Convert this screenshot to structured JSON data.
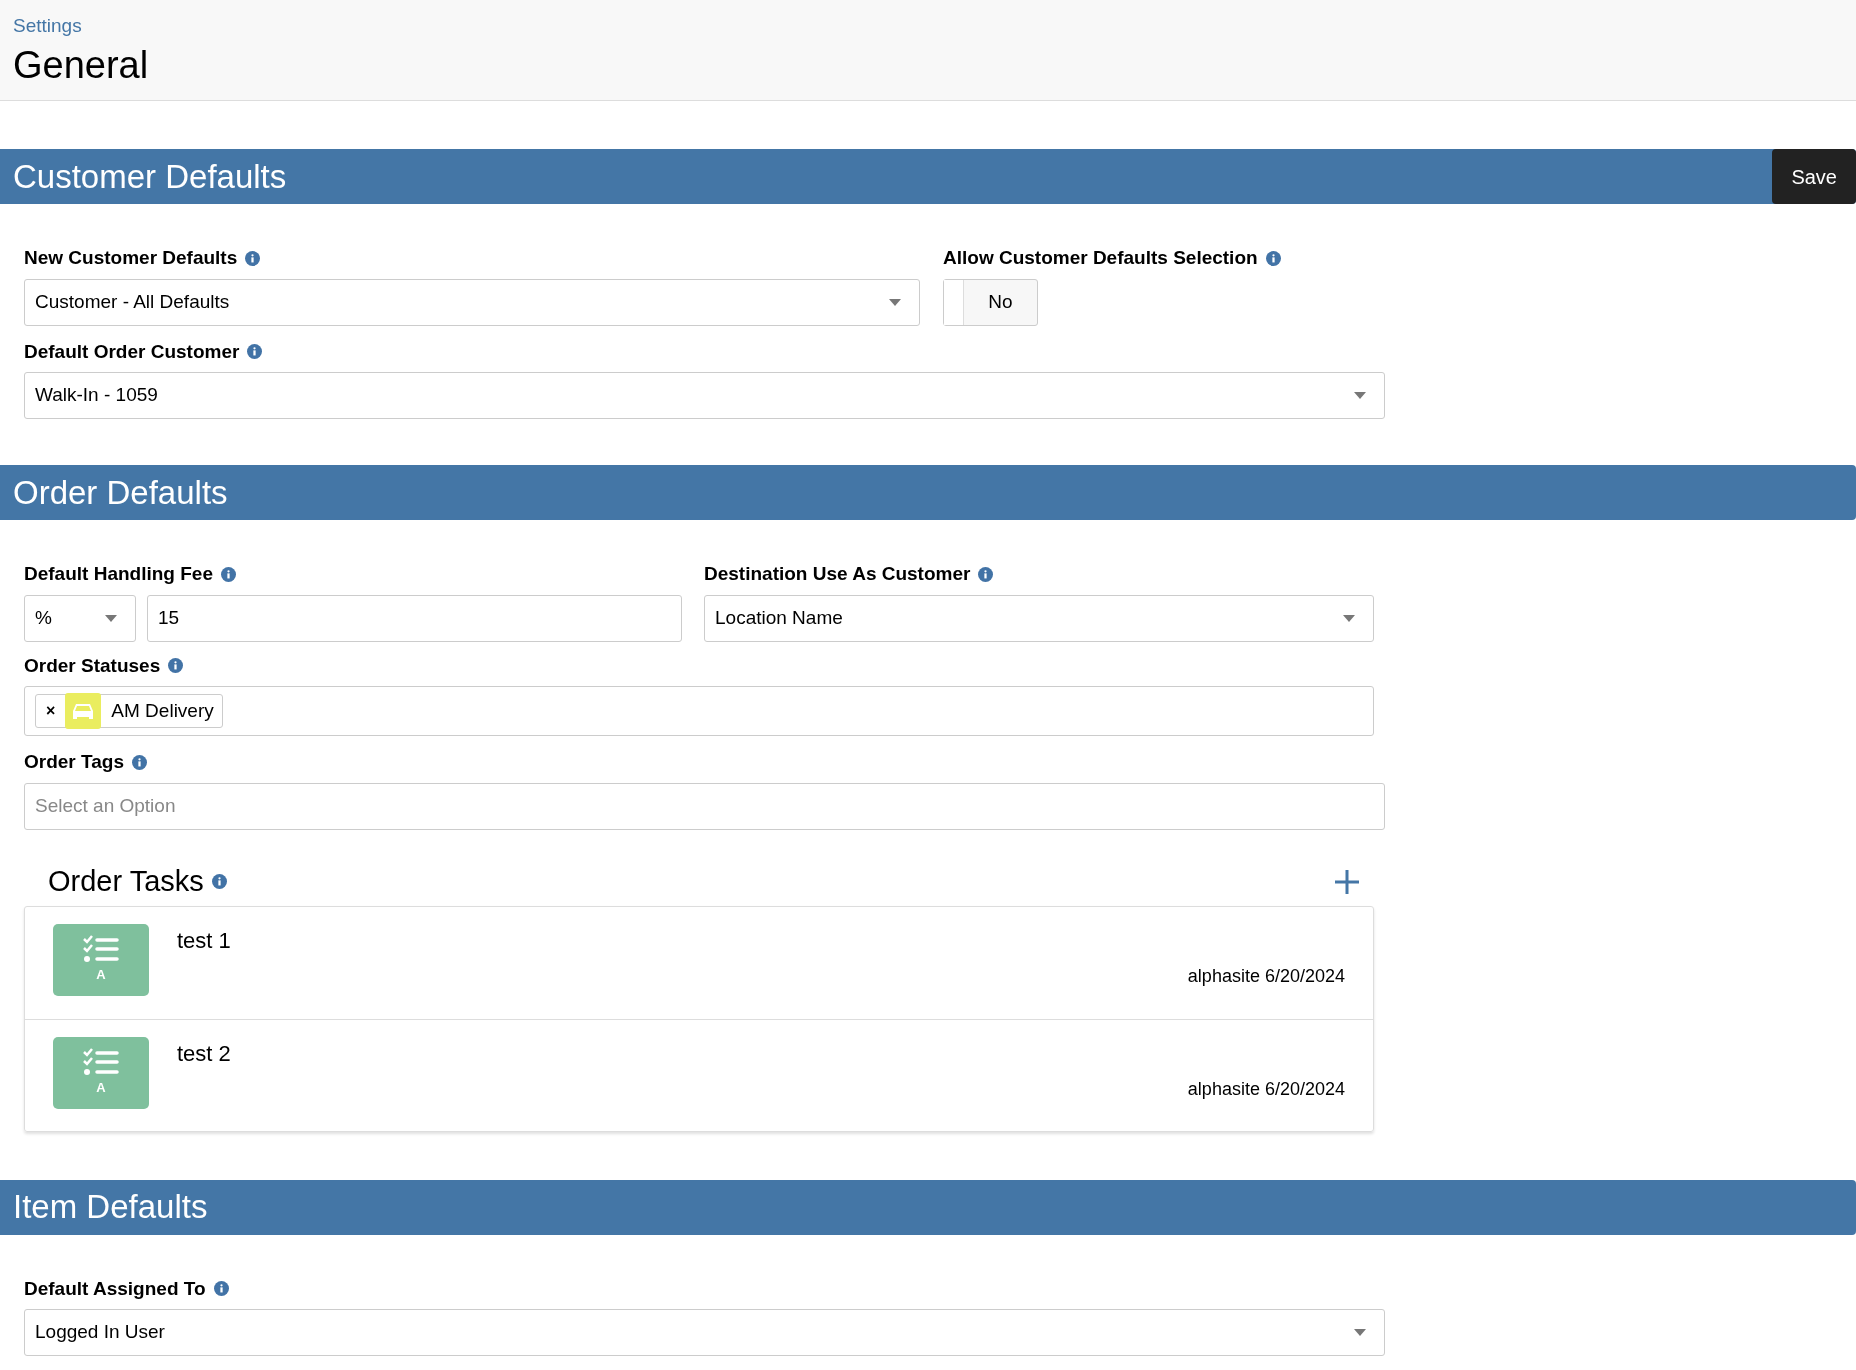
{
  "header": {
    "breadcrumb": "Settings",
    "title": "General"
  },
  "customer_defaults": {
    "title": "Customer Defaults",
    "save_button": "Save",
    "new_customer_defaults": {
      "label": "New Customer Defaults",
      "value": "Customer - All Defaults"
    },
    "allow_selection": {
      "label": "Allow Customer Defaults Selection",
      "on": false,
      "text": "No"
    },
    "default_order_customer": {
      "label": "Default Order Customer",
      "value": "Walk-In - 1059"
    }
  },
  "order_defaults": {
    "title": "Order Defaults",
    "handling_fee": {
      "label": "Default Handling Fee",
      "unit": "%",
      "value": "15"
    },
    "destination": {
      "label": "Destination Use As Customer",
      "value": "Location Name"
    },
    "order_statuses": {
      "label": "Order Statuses",
      "chips": [
        {
          "remove": "×",
          "label": "AM Delivery",
          "color": "#eaed5f"
        }
      ]
    },
    "order_tags": {
      "label": "Order Tags",
      "placeholder": "Select an Option"
    },
    "order_tasks": {
      "title": "Order Tasks",
      "items": [
        {
          "badge": "A",
          "name": "test 1",
          "meta": "alphasite 6/20/2024"
        },
        {
          "badge": "A",
          "name": "test 2",
          "meta": "alphasite 6/20/2024"
        }
      ]
    }
  },
  "item_defaults": {
    "title": "Item Defaults",
    "default_assigned_to": {
      "label": "Default Assigned To",
      "value": "Logged In User"
    }
  }
}
